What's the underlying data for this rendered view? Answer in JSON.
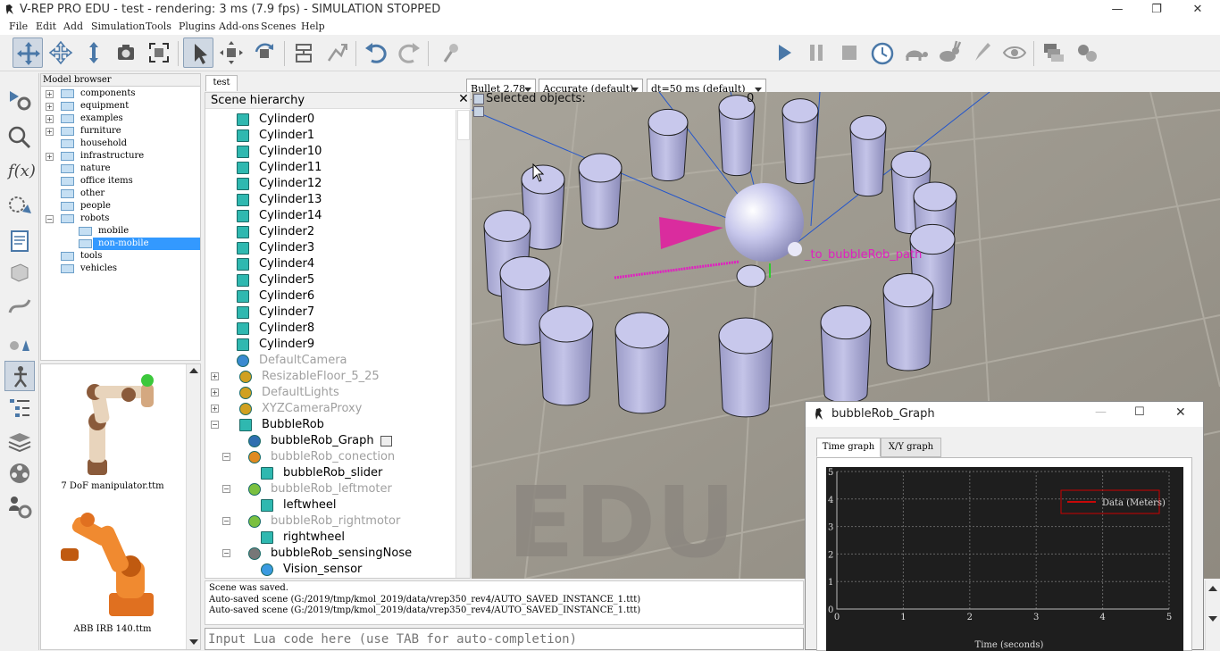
{
  "window": {
    "title": "V-REP PRO EDU - test - rendering: 3 ms (7.9 fps) - SIMULATION STOPPED",
    "minimize": "—",
    "restore": "❐",
    "close": "✕"
  },
  "menu": [
    "File",
    "Edit",
    "Add",
    "Simulation",
    "Tools",
    "Plugins",
    "Add-ons",
    "Scenes",
    "Help"
  ],
  "toolbar": {
    "engine": "Bullet 2.78",
    "accuracy": "Accurate (default)",
    "timestep": "dt=50 ms (default)",
    "icons": [
      "camera-pan-icon",
      "camera-rotate-icon",
      "camera-shift-icon",
      "camera-angle-icon",
      "fit-to-view-icon",
      "click-select-icon",
      "object-shift-icon",
      "object-rotate-icon",
      "assemble-icon",
      "transfer-dna-icon",
      "undo-icon",
      "redo-icon",
      "dynamics-icon",
      "start-simulation-icon",
      "pause-simulation-icon",
      "stop-simulation-icon",
      "real-time-icon",
      "slow-down-icon",
      "speed-up-icon",
      "thread-rendering-icon",
      "visualization-icon",
      "page-selector-icon",
      "scene-selector-icon"
    ]
  },
  "left_toolbar": [
    "simulation-settings-icon",
    "selection-icon",
    "calculation-modules-icon",
    "collections-icon",
    "scripts-icon",
    "shape-edit-icon",
    "path-edit-icon",
    "user-settings-icon",
    "model-browser-icon",
    "scene-hierarchy-icon",
    "layers-icon",
    "video-recorder-icon",
    "user-settings-icon-2"
  ],
  "model_browser": {
    "header": "Model browser",
    "items": [
      {
        "label": "components",
        "expand": "+",
        "level": 0
      },
      {
        "label": "equipment",
        "expand": "+",
        "level": 0
      },
      {
        "label": "examples",
        "expand": "+",
        "level": 0
      },
      {
        "label": "furniture",
        "expand": "+",
        "level": 0
      },
      {
        "label": "household",
        "expand": "",
        "level": 0
      },
      {
        "label": "infrastructure",
        "expand": "+",
        "level": 0
      },
      {
        "label": "nature",
        "expand": "",
        "level": 0
      },
      {
        "label": "office items",
        "expand": "",
        "level": 0
      },
      {
        "label": "other",
        "expand": "",
        "level": 0
      },
      {
        "label": "people",
        "expand": "",
        "level": 0
      },
      {
        "label": "robots",
        "expand": "−",
        "level": 0
      },
      {
        "label": "mobile",
        "expand": "",
        "level": 1
      },
      {
        "label": "non-mobile",
        "expand": "",
        "level": 1,
        "selected": true
      },
      {
        "label": "tools",
        "expand": "",
        "level": 0
      },
      {
        "label": "vehicles",
        "expand": "",
        "level": 0
      }
    ],
    "thumbnails": [
      "7 DoF manipulator.ttm",
      "ABB IRB 140.ttm"
    ]
  },
  "scene_tab": "test",
  "scene_hierarchy": {
    "header": "Scene hierarchy",
    "items": [
      {
        "label": "Cylinder0",
        "level": 2,
        "dim": false,
        "icon": "shape-icon"
      },
      {
        "label": "Cylinder1",
        "level": 2,
        "dim": false,
        "icon": "shape-icon"
      },
      {
        "label": "Cylinder10",
        "level": 2,
        "dim": false,
        "icon": "shape-icon"
      },
      {
        "label": "Cylinder11",
        "level": 2,
        "dim": false,
        "icon": "shape-icon"
      },
      {
        "label": "Cylinder12",
        "level": 2,
        "dim": false,
        "icon": "shape-icon"
      },
      {
        "label": "Cylinder13",
        "level": 2,
        "dim": false,
        "icon": "shape-icon"
      },
      {
        "label": "Cylinder14",
        "level": 2,
        "dim": false,
        "icon": "shape-icon"
      },
      {
        "label": "Cylinder2",
        "level": 2,
        "dim": false,
        "icon": "shape-icon"
      },
      {
        "label": "Cylinder3",
        "level": 2,
        "dim": false,
        "icon": "shape-icon"
      },
      {
        "label": "Cylinder4",
        "level": 2,
        "dim": false,
        "icon": "shape-icon"
      },
      {
        "label": "Cylinder5",
        "level": 2,
        "dim": false,
        "icon": "shape-icon"
      },
      {
        "label": "Cylinder6",
        "level": 2,
        "dim": false,
        "icon": "shape-icon"
      },
      {
        "label": "Cylinder7",
        "level": 2,
        "dim": false,
        "icon": "shape-icon"
      },
      {
        "label": "Cylinder8",
        "level": 2,
        "dim": false,
        "icon": "shape-icon"
      },
      {
        "label": "Cylinder9",
        "level": 2,
        "dim": false,
        "icon": "shape-icon"
      },
      {
        "label": "DefaultCamera",
        "level": 2,
        "dim": true,
        "icon": "camera-icon"
      },
      {
        "label": "ResizableFloor_5_25",
        "level": 1,
        "dim": true,
        "icon": "model-shape-icon",
        "expander": "+"
      },
      {
        "label": "DefaultLights",
        "level": 1,
        "dim": true,
        "icon": "model-light-icon",
        "expander": "+"
      },
      {
        "label": "XYZCameraProxy",
        "level": 1,
        "dim": true,
        "icon": "model-dummy-icon",
        "expander": "+"
      },
      {
        "label": "BubbleRob",
        "level": 1,
        "dim": false,
        "icon": "shape-icon",
        "expander": "−"
      },
      {
        "label": "bubbleRob_Graph",
        "level": 3,
        "dim": false,
        "icon": "graph-icon",
        "script": true
      },
      {
        "label": "bubbleRob_conection",
        "level": 3,
        "dim": true,
        "icon": "force-sensor-icon",
        "expander": "−"
      },
      {
        "label": "bubbleRob_slider",
        "level": 4,
        "dim": false,
        "icon": "shape-icon"
      },
      {
        "label": "bubbleRob_leftmoter",
        "level": 3,
        "dim": true,
        "icon": "joint-icon",
        "expander": "−"
      },
      {
        "label": "leftwheel",
        "level": 4,
        "dim": false,
        "icon": "shape-icon"
      },
      {
        "label": "bubbleRob_rightmotor",
        "level": 3,
        "dim": true,
        "icon": "joint-icon",
        "expander": "−"
      },
      {
        "label": "rightwheel",
        "level": 4,
        "dim": false,
        "icon": "shape-icon"
      },
      {
        "label": "bubbleRob_sensingNose",
        "level": 3,
        "dim": false,
        "icon": "proximity-sensor-icon",
        "expander": "−"
      },
      {
        "label": "Vision_sensor",
        "level": 4,
        "dim": false,
        "icon": "vision-sensor-icon"
      }
    ]
  },
  "viewport": {
    "selected_label": "Selected objects:",
    "selected_count": "0",
    "path_label": "_to_bubbleRob_path",
    "watermark": "EDU"
  },
  "status": {
    "lines": [
      "Scene was saved.",
      "Auto-saved scene (G:/2019/tmp/kmol_2019/data/vrep350_rev4/AUTO_SAVED_INSTANCE_1.ttt)",
      "Auto-saved scene (G:/2019/tmp/kmol_2019/data/vrep350_rev4/AUTO_SAVED_INSTANCE_1.ttt)"
    ]
  },
  "lua_input": {
    "placeholder": "Input Lua code here (use TAB for auto-completion)"
  },
  "graph_window": {
    "title": "bubbleRob_Graph",
    "tabs": [
      "Time graph",
      "X/Y graph"
    ],
    "active_tab": "Time graph"
  },
  "chart_data": {
    "type": "line",
    "xlabel": "Time (seconds)",
    "ylabel": "",
    "xlim": [
      0,
      5
    ],
    "ylim": [
      0,
      5
    ],
    "xticks": [
      "0",
      "1",
      "2",
      "3",
      "4",
      "5"
    ],
    "yticks": [
      "0",
      "1",
      "2",
      "3",
      "4",
      "5"
    ],
    "grid": true,
    "legend_position": "top-right",
    "series": [
      {
        "name": "Data (Meters)",
        "values": [],
        "color": "#ff0000"
      }
    ],
    "background": "#1e1e1e"
  },
  "colors": {
    "accent": "#3399ff",
    "path": "#e020c0",
    "cylinder": "#b8b8e0"
  }
}
